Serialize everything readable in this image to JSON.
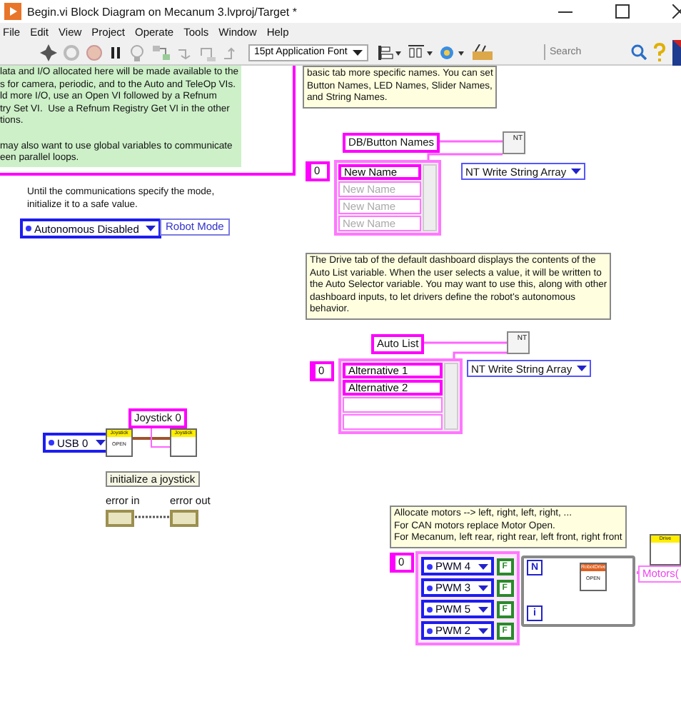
{
  "window": {
    "title": "Begin.vi Block Diagram on Mecanum 3.lvproj/Target *"
  },
  "menu": [
    "File",
    "Edit",
    "View",
    "Project",
    "Operate",
    "Tools",
    "Window",
    "Help"
  ],
  "toolbar": {
    "font": "15pt Application Font",
    "search": {
      "placeholder": "Search"
    }
  },
  "diagram": {
    "intro_note": {
      "paragraphs": [
        [
          "lata and I/O allocated here will be made available to the",
          "s for camera, periodic, and to the Auto and TeleOp VIs.",
          "ld more I/O, use an Open VI followed by a Refnum",
          "try Set VI.  Use a Refnum Registry Get VI in the other",
          "tions."
        ],
        [
          "may also want to use global variables to communicate",
          "een parallel loops."
        ]
      ]
    },
    "names_note": {
      "lines": [
        "basic tab more specific names. You can set",
        "Button Names, LED Names, Slider Names,",
        "and String Names."
      ]
    },
    "mode_note": {
      "lines": [
        "Until the communications specify the mode,",
        "initialize it to a safe value."
      ]
    },
    "mode": {
      "value": "Autonomous Disabled",
      "target": "Robot Mode"
    },
    "button_names": {
      "name": "DB/Button Names",
      "node": "NT",
      "index": "0",
      "function": "NT Write String Array",
      "items": [
        {
          "text": "New Name",
          "dimmed": false
        },
        {
          "text": "New Name",
          "dimmed": true
        },
        {
          "text": "New Name",
          "dimmed": true
        },
        {
          "text": "New Name",
          "dimmed": true
        }
      ]
    },
    "auto_note": {
      "lines": [
        "The Drive tab of the default dashboard displays the contents of the",
        "Auto List variable. When the user selects a value, it will be written to",
        "the Auto Selector variable. You may want to use this, along with other",
        "dashboard inputs, to let drivers define the robot's autonomous",
        "behavior."
      ]
    },
    "auto_list": {
      "name": "Auto List",
      "node": "NT",
      "index": "0",
      "function": "NT Write String Array",
      "items": [
        {
          "text": "Alternative 1",
          "dimmed": false
        },
        {
          "text": "Alternative 2",
          "dimmed": false
        }
      ]
    },
    "joystick": {
      "name": "Joystick 0",
      "device": "USB 0",
      "open_header": "Joystick",
      "open_label": "OPEN",
      "set_header": "Joystick",
      "caption": "initialize a joystick"
    },
    "errors": {
      "in": "error in",
      "out": "error out"
    },
    "motors_note": {
      "lines": [
        "Allocate motors --> left, right, left, right, ...",
        "For CAN motors replace Motor Open.",
        "For Mecanum, left rear, right rear, left front, right front"
      ]
    },
    "motors": {
      "index": "0",
      "channels": [
        {
          "name": "PWM 4",
          "inverted": "F"
        },
        {
          "name": "PWM 3",
          "inverted": "F"
        },
        {
          "name": "PWM 5",
          "inverted": "F"
        },
        {
          "name": "PWM 2",
          "inverted": "F"
        }
      ],
      "loop_count": "N",
      "loop_index": "i",
      "open_header": "RobotDrive",
      "open_label": "OPEN",
      "drive_label": "Drive",
      "output": "Motors("
    }
  }
}
